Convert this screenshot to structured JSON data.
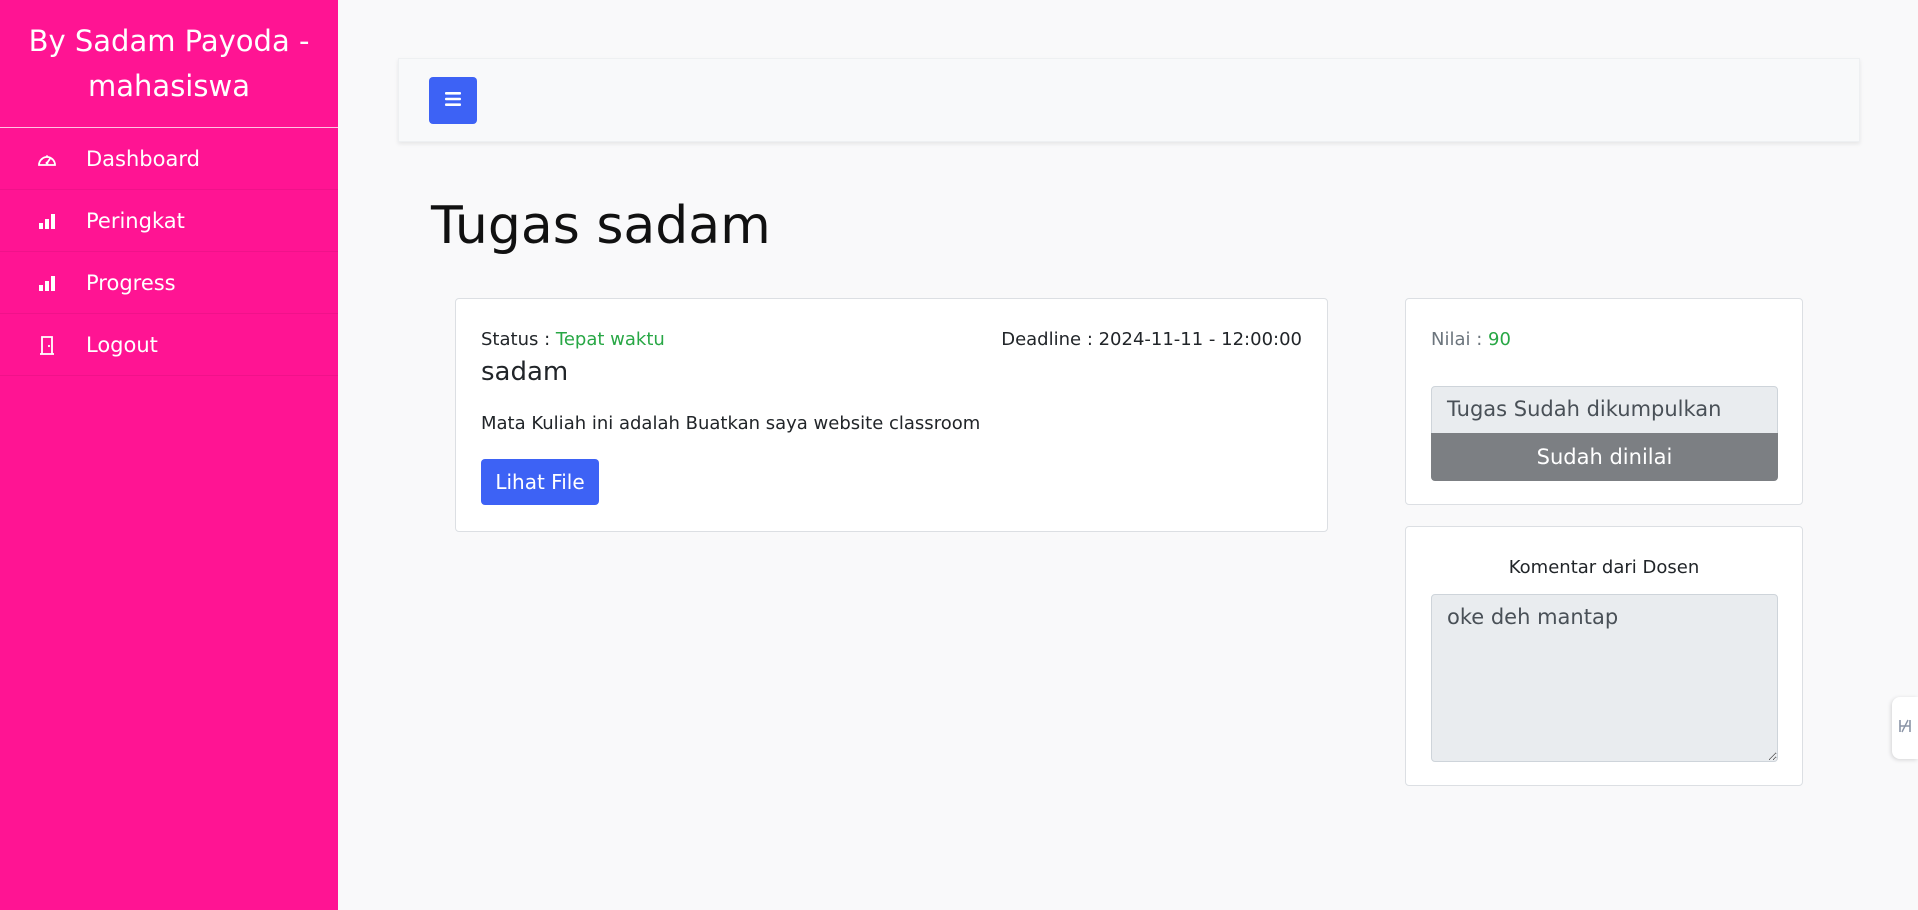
{
  "sidebar": {
    "brand": "By Sadam Payoda - mahasiswa",
    "items": [
      {
        "label": "Dashboard",
        "icon": "speedometer-icon"
      },
      {
        "label": "Peringkat",
        "icon": "bar-chart-icon"
      },
      {
        "label": "Progress",
        "icon": "bar-chart-icon"
      },
      {
        "label": "Logout",
        "icon": "door-icon"
      }
    ]
  },
  "topbar": {
    "toggle_icon": "hamburger-icon"
  },
  "page": {
    "title": "Tugas sadam"
  },
  "task": {
    "status_label": "Status :",
    "status_value": "Tepat waktu",
    "deadline": "Deadline : 2024-11-11 - 12:00:00",
    "name": "sadam",
    "description": "Mata Kuliah ini adalah Buatkan saya website classroom",
    "file_button": "Lihat File"
  },
  "grade": {
    "label": "Nilai :",
    "value": "90",
    "submitted_text": "Tugas Sudah dikumpulkan",
    "graded_button": "Sudah dinilai"
  },
  "comment": {
    "title": "Komentar dari Dosen",
    "text": "oke deh mantap"
  },
  "colors": {
    "sidebar": "#ff1493",
    "primary": "#3d62f5",
    "success": "#28a745",
    "secondary": "#7c7f83"
  }
}
